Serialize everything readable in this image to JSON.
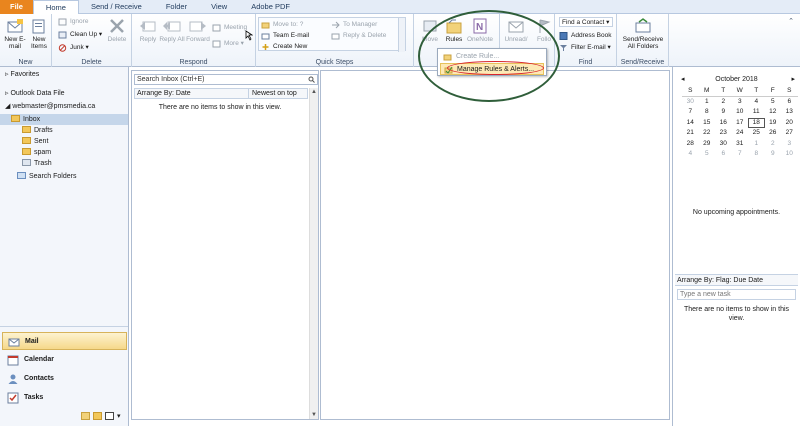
{
  "tabs": [
    "File",
    "Home",
    "Send / Receive",
    "Folder",
    "View",
    "Adobe PDF"
  ],
  "groups": {
    "new": {
      "label": "New",
      "new_email": "New E-mail",
      "new_items": "New Items"
    },
    "delete": {
      "label": "Delete",
      "ignore": "Ignore",
      "clean_up": "Clean Up",
      "junk": "Junk",
      "delete": "Delete"
    },
    "respond": {
      "label": "Respond",
      "reply": "Reply",
      "reply_all": "Reply All",
      "forward": "Forward",
      "meeting": "Meeting",
      "more": "More"
    },
    "quick_steps": {
      "label": "Quick Steps",
      "items": [
        "Move to: ?",
        "To Manager",
        "Team E-mail",
        "Reply & Delete",
        "Create New"
      ]
    },
    "move": {
      "move": "Move",
      "rules": "Rules",
      "onenote": "OneNote"
    },
    "tags": {
      "unread": "Unread/",
      "follow": "Follo"
    },
    "find": {
      "label": "Find",
      "find_contact": "Find a Contact",
      "address_book": "Address Book",
      "filter_email": "Filter E-mail"
    },
    "send_receive": {
      "label": "Send/Receive",
      "button": "Send/Receive All Folders"
    }
  },
  "rules_menu": {
    "create_rule": "Create Rule...",
    "manage_rules": "Manage Rules & Alerts..."
  },
  "nav": {
    "favorites": "Favorites",
    "data_file": "Outlook Data File",
    "account": "webmaster@pmsmedia.ca",
    "folders": [
      "Inbox",
      "Drafts",
      "Sent",
      "spam",
      "Trash"
    ],
    "search_folders": "Search Folders",
    "buttons": [
      "Mail",
      "Calendar",
      "Contacts",
      "Tasks"
    ]
  },
  "list": {
    "search_placeholder": "Search Inbox (Ctrl+E)",
    "arrange_by": "Arrange By: Date",
    "sort": "Newest on top",
    "empty": "There are no items to show in this view."
  },
  "todo": {
    "month": "October 2018",
    "weekdays": [
      "S",
      "M",
      "T",
      "W",
      "T",
      "F",
      "S"
    ],
    "weeks": [
      [
        "30",
        "1",
        "2",
        "3",
        "4",
        "5",
        "6"
      ],
      [
        "7",
        "8",
        "9",
        "10",
        "11",
        "12",
        "13"
      ],
      [
        "14",
        "15",
        "16",
        "17",
        "18",
        "19",
        "20"
      ],
      [
        "21",
        "22",
        "23",
        "24",
        "25",
        "26",
        "27"
      ],
      [
        "28",
        "29",
        "30",
        "31",
        "1",
        "2",
        "3"
      ],
      [
        "4",
        "5",
        "6",
        "7",
        "8",
        "9",
        "10"
      ]
    ],
    "today": "18",
    "no_appointments": "No upcoming appointments.",
    "task_arrange": "Arrange By: Flag: Due Date",
    "task_placeholder": "Type a new task",
    "task_empty": "There are no items to show in this view."
  },
  "colors": {
    "file_tab": "#e9851e",
    "annotation_red": "#d8242b",
    "annotation_green": "#2f5e3a",
    "selection": "#c5d6ea"
  }
}
